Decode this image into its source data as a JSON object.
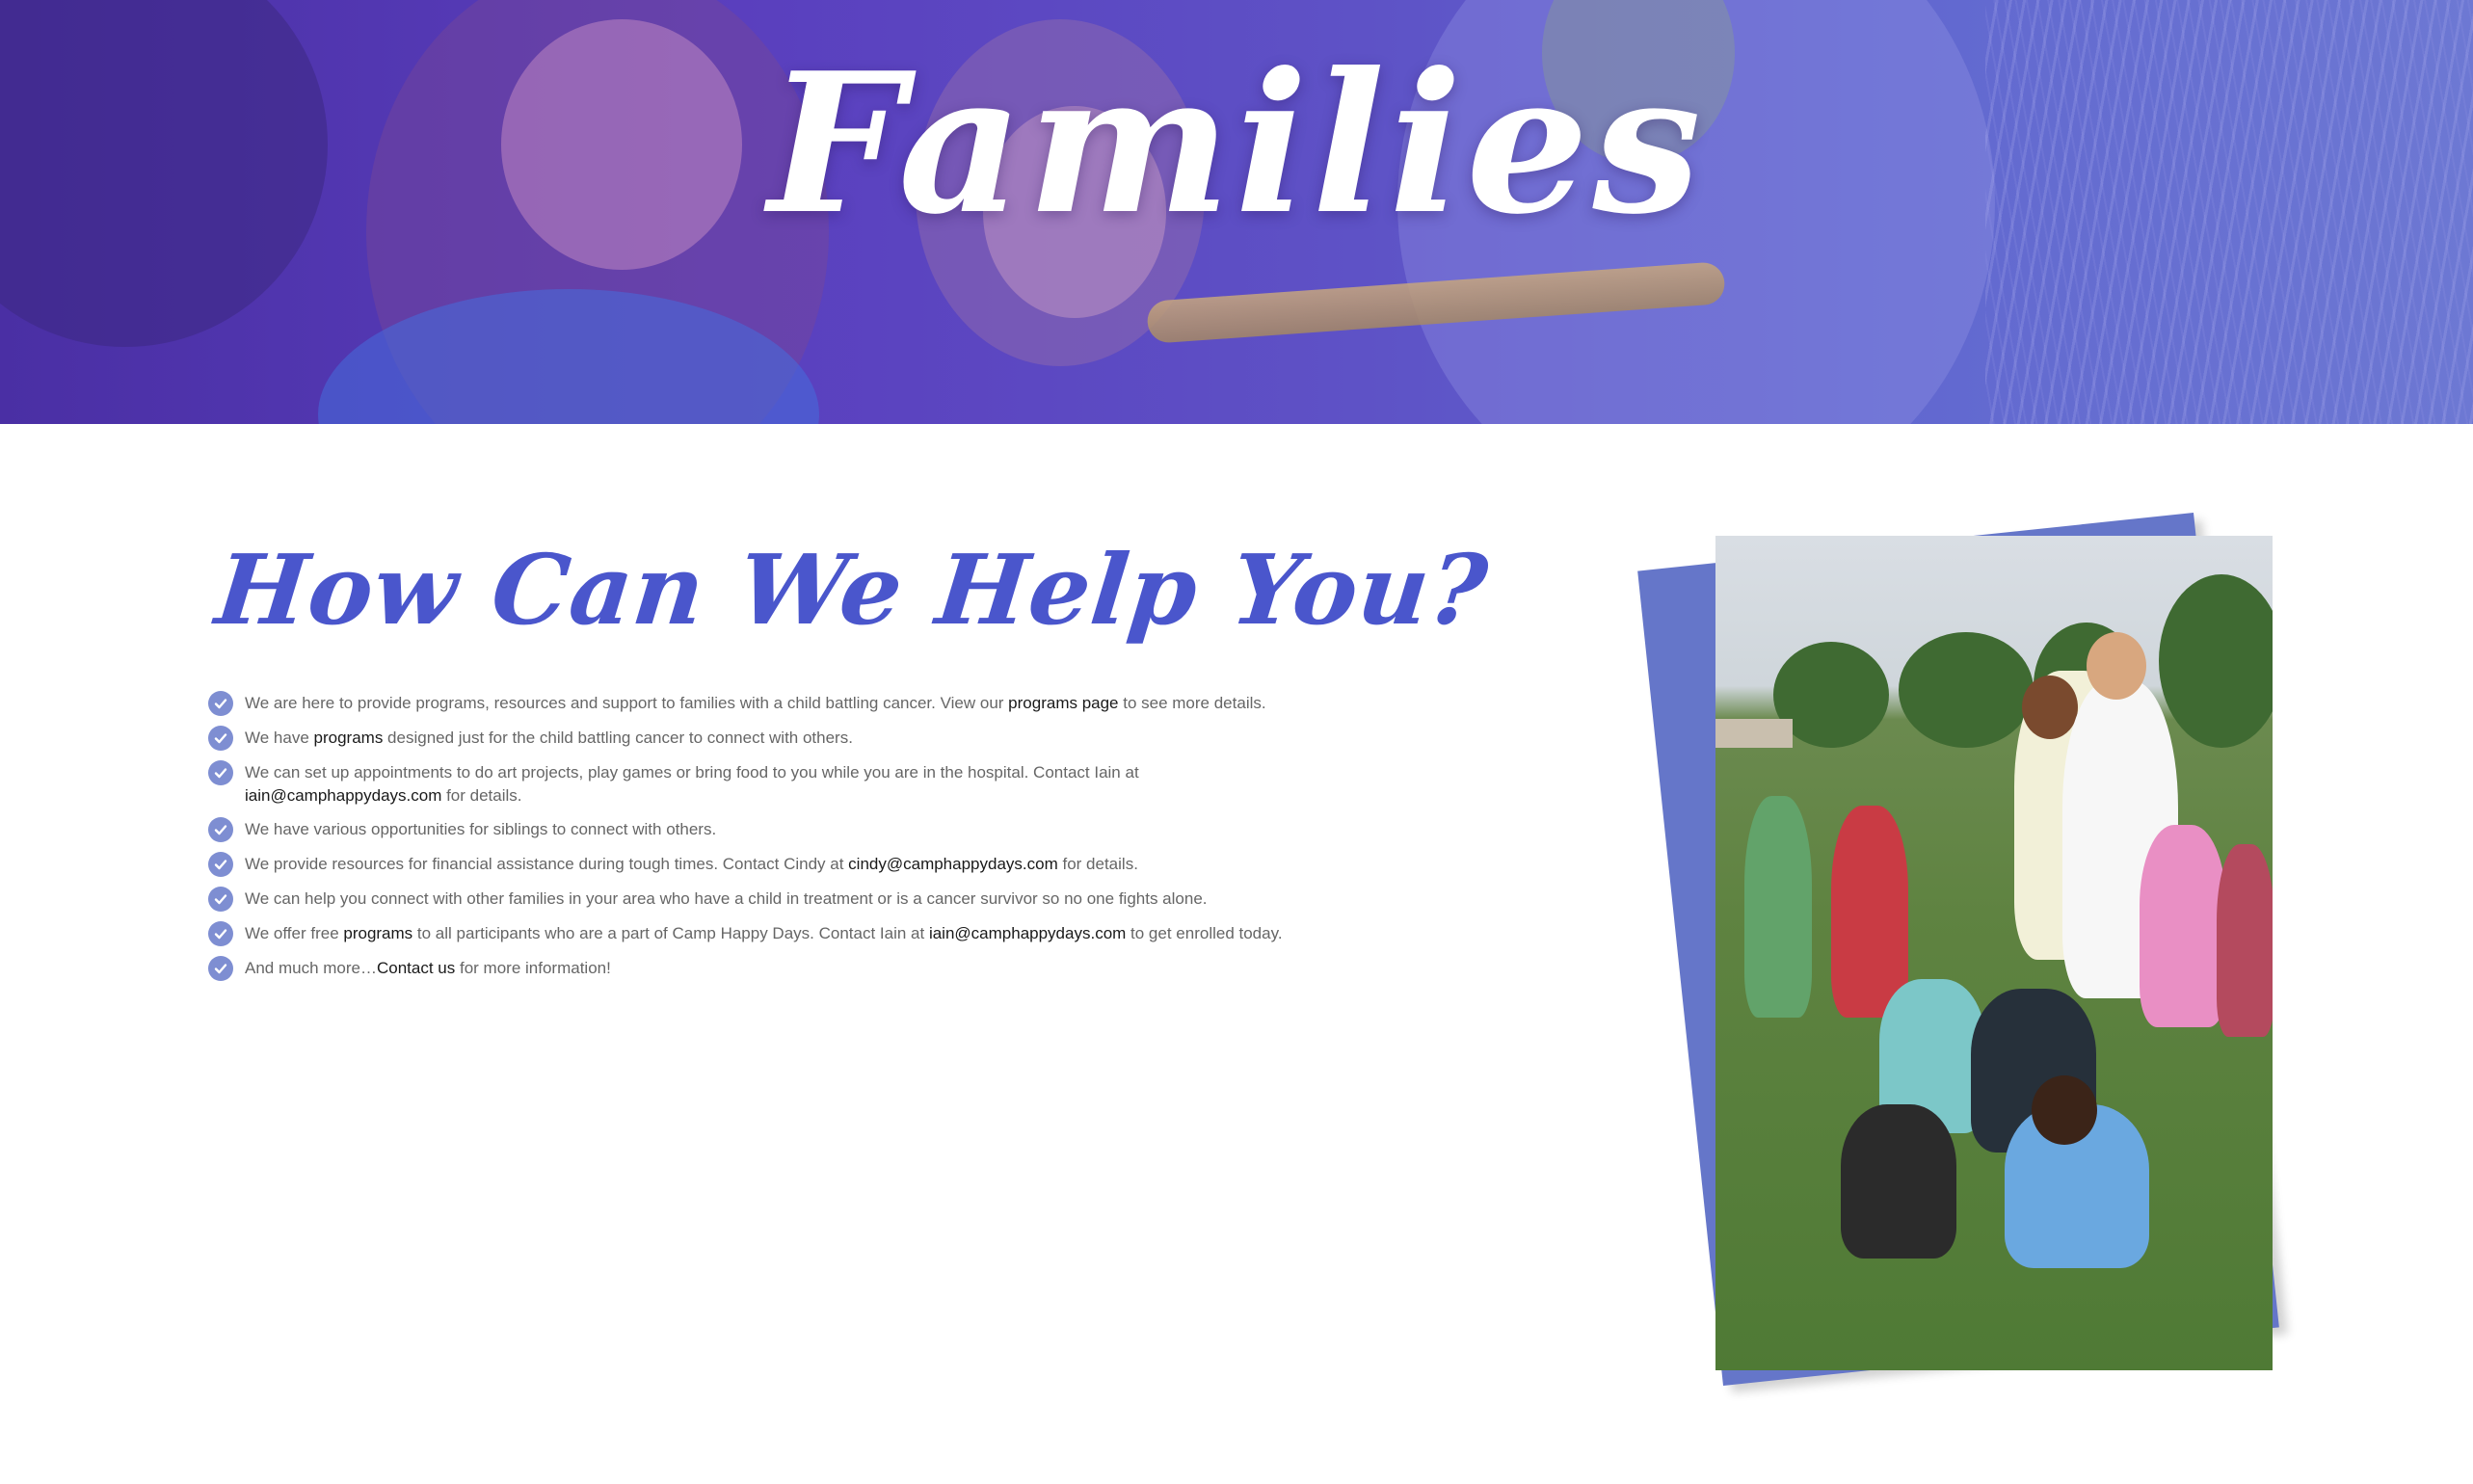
{
  "hero": {
    "title": "Families"
  },
  "help": {
    "heading": "How Can We Help You?",
    "items": [
      {
        "before": "We are here to provide programs, resources and support to families with a child battling cancer. View our ",
        "link": "programs page",
        "after": " to see more details."
      },
      {
        "before": "We have ",
        "link": "programs",
        "after": " designed just for the child battling cancer to connect with others."
      },
      {
        "before": "We can set up appointments to do art projects, play games or bring food to you while you are in the hospital. Contact Iain at ",
        "link": "iain@camphappydays.com",
        "after": " for details."
      },
      {
        "before": "We have various opportunities for siblings to connect with others.",
        "link": "",
        "after": ""
      },
      {
        "before": "We provide resources for financial assistance during tough times. Contact Cindy at ",
        "link": "cindy@camphappydays.com",
        "after": " for details."
      },
      {
        "before": "We can help you connect with other families in your area who have a child in treatment or is a cancer survivor so no one fights alone.",
        "link": "",
        "after": ""
      },
      {
        "before": "We offer free ",
        "link": "programs",
        "after": " to all participants who are a part of Camp Happy Days. Contact Iain at ",
        "link2": "iain@camphappydays.com",
        "after2": " to get enrolled today."
      },
      {
        "before": "And much more…",
        "link": "Contact us",
        "after": " for more information!"
      }
    ]
  },
  "colors": {
    "hero_overlay": "#5a3fbe",
    "heading": "#4a56cc",
    "check": "#7e8ed2",
    "photo_back": "#6576c9",
    "body_text": "#666666",
    "link_text": "#1a1a1a"
  },
  "icons": {
    "list_bullet": "check-circle-icon"
  }
}
